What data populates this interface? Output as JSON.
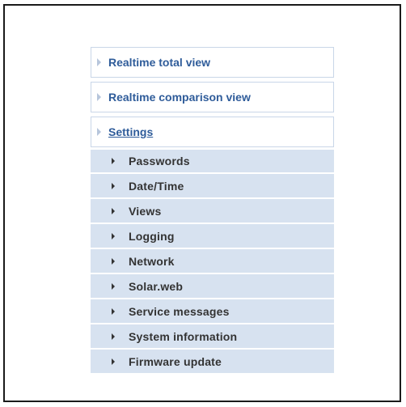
{
  "menu": {
    "main_items": [
      {
        "label": "Realtime total view"
      },
      {
        "label": "Realtime comparison view"
      },
      {
        "label": "Settings"
      }
    ],
    "settings_items": [
      {
        "label": "Passwords"
      },
      {
        "label": "Date/Time"
      },
      {
        "label": "Views"
      },
      {
        "label": "Logging"
      },
      {
        "label": "Network"
      },
      {
        "label": "Solar.web"
      },
      {
        "label": "Service messages"
      },
      {
        "label": "System information"
      },
      {
        "label": "Firmware update"
      }
    ]
  },
  "colors": {
    "link_blue": "#2f5c9a",
    "submenu_bg": "#d7e2f0",
    "border": "#c9d6e8"
  }
}
